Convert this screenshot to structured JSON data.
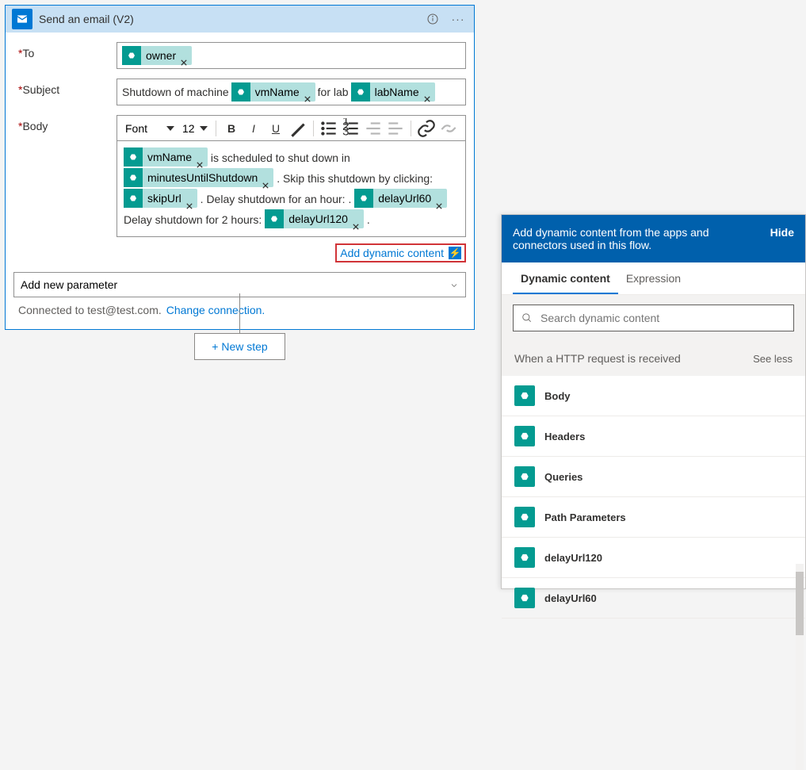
{
  "card": {
    "title": "Send an email (V2)",
    "rows": {
      "to": {
        "label": "To"
      },
      "subject": {
        "label": "Subject",
        "prefix": "Shutdown of machine",
        "mid": "for lab"
      },
      "body": {
        "label": "Body"
      }
    },
    "tokens": {
      "owner": "owner",
      "vmName": "vmName",
      "labName": "labName",
      "minutes": "minutesUntilShutdown",
      "skipUrl": "skipUrl",
      "delay60": "delayUrl60",
      "delay120": "delayUrl120"
    },
    "bodyText": {
      "t1": "is scheduled to shut down in",
      "t2": ". Skip this shutdown by clicking:",
      "t3": ". Delay shutdown for an hour: .",
      "t4": "Delay shutdown for 2 hours:",
      "t5": "."
    },
    "toolbar": {
      "font": "Font",
      "size": "12"
    },
    "dynLink": "Add dynamic content",
    "addParam": "Add new parameter",
    "footer": {
      "text": "Connected to test@test.com.",
      "link": "Change connection."
    }
  },
  "newStep": "+ New step",
  "panel": {
    "headerText": "Add dynamic content from the apps and connectors used in this flow.",
    "hide": "Hide",
    "tabs": {
      "dynamic": "Dynamic content",
      "expression": "Expression"
    },
    "searchPlaceholder": "Search dynamic content",
    "group": "When a HTTP request is received",
    "seeLess": "See less",
    "items": [
      "Body",
      "Headers",
      "Queries",
      "Path Parameters",
      "delayUrl120",
      "delayUrl60"
    ]
  }
}
